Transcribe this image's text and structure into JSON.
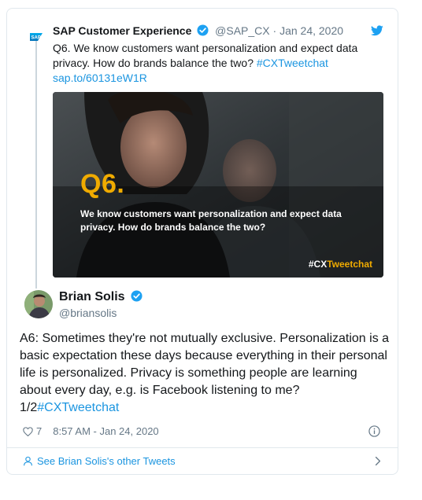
{
  "quoted_tweet": {
    "author_name": "SAP Customer Experience",
    "handle": "@SAP_CX",
    "separator": " · ",
    "date": "Jan 24, 2020",
    "text_line": "Q6. We know customers want personalization and expect data privacy. How do brands balance the two? ",
    "hashtag": "#CXTweetchat",
    "link": "sap.to/60131eW1R",
    "logo_text": "SAP",
    "media": {
      "heading": "Q6.",
      "text": "We know customers want personalization and expect data privacy. How do brands balance the two?",
      "tag_prefix": "#CX",
      "tag_suffix": "Tweetchat"
    }
  },
  "tweet": {
    "author_name": "Brian Solis",
    "handle": "@briansolis",
    "text": "A6: Sometimes they're not mutually exclusive. Personalization is a basic expectation these days because everything in their personal life is personalized. Privacy is something people are learning about every day, e.g. is Facebook listening to me? 1/2",
    "hashtag": "#CXTweetchat",
    "likes": "7",
    "timestamp": "8:57 AM - Jan 24, 2020"
  },
  "footer": {
    "label": "See Brian Solis's other Tweets"
  },
  "colors": {
    "link": "#1b95e0",
    "sap_gold": "#f0ab00",
    "muted": "#657786",
    "border": "#e1e8ed"
  },
  "icons": [
    "sap-logo-icon",
    "verified-badge-icon",
    "twitter-bird-icon",
    "heart-icon",
    "info-icon",
    "user-icon",
    "chevron-right-icon"
  ]
}
